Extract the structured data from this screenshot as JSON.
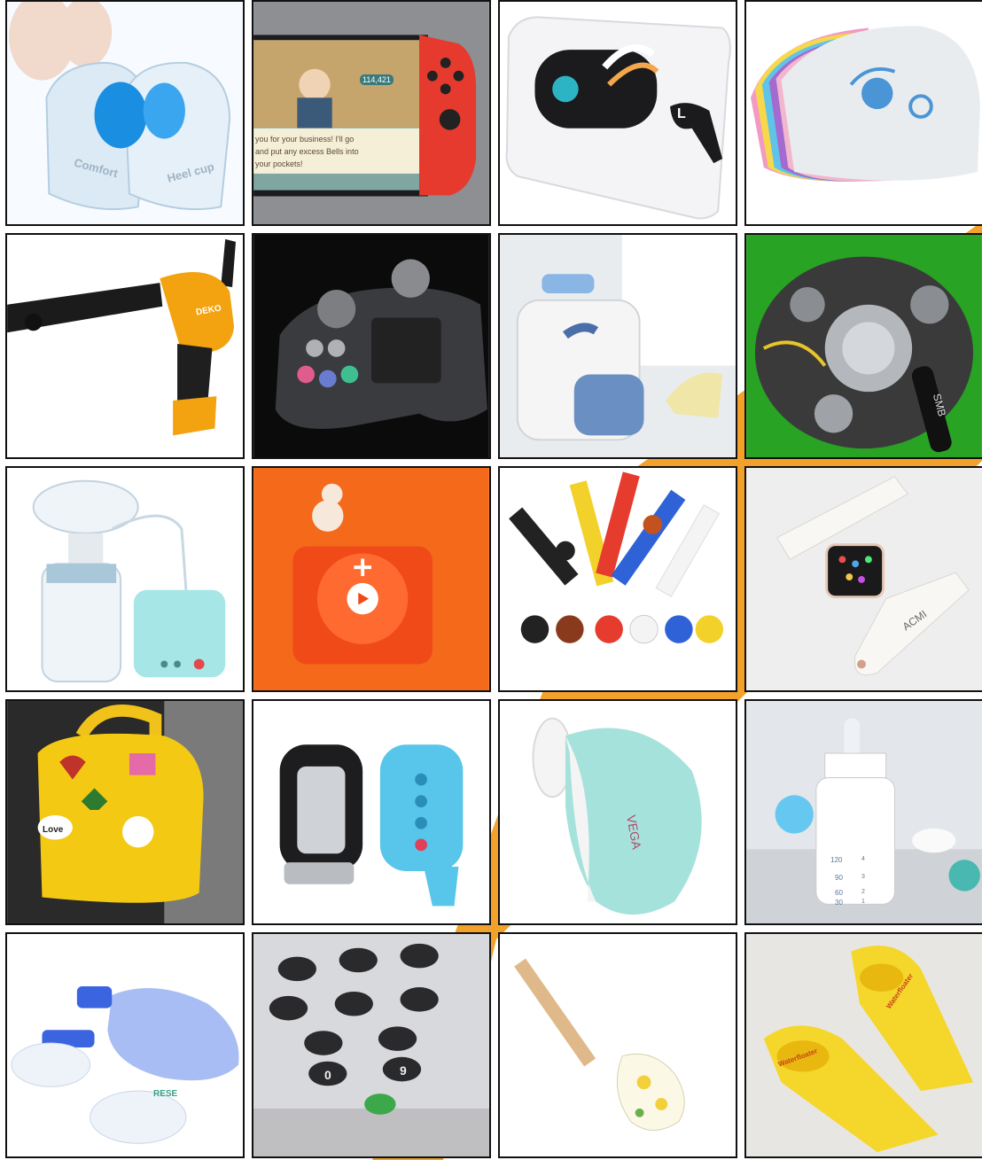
{
  "colors": {
    "accent_band": "#f2a22a",
    "tile_border": "#111111"
  },
  "tiles": [
    {
      "name": "heel-cups",
      "text": {
        "a": "Comfort",
        "b": "Heel cup"
      }
    },
    {
      "name": "game-console",
      "text": {
        "score": "114,421",
        "dialog1": "you for your business! I'll go",
        "dialog2": "and put any excess Bells into",
        "dialog3": "your pockets!"
      }
    },
    {
      "name": "earbuds-case",
      "text": {
        "letter": "L"
      }
    },
    {
      "name": "swim-caps",
      "text": {}
    },
    {
      "name": "caulking-gun",
      "text": {
        "brand": "DEKO"
      }
    },
    {
      "name": "game-controller",
      "text": {}
    },
    {
      "name": "bags-accessories",
      "text": {}
    },
    {
      "name": "car-engine",
      "text": {
        "hose": "SMB"
      }
    },
    {
      "name": "breast-pump",
      "text": {}
    },
    {
      "name": "music-player",
      "text": {}
    },
    {
      "name": "slap-bracelets",
      "text": {}
    },
    {
      "name": "watch-band",
      "text": {
        "band": "ACMI"
      }
    },
    {
      "name": "backpack",
      "text": {
        "badge": "Love"
      }
    },
    {
      "name": "key-fob-cover",
      "text": {}
    },
    {
      "name": "face-brush",
      "text": {
        "brand": "VEGA"
      }
    },
    {
      "name": "baby-bottle",
      "text": {
        "m1": "120",
        "m2": "90",
        "m3": "60",
        "m4": "30",
        "n4": "4",
        "n3": "3",
        "n2": "2",
        "n1": "1"
      }
    },
    {
      "name": "resuscitator",
      "text": {
        "mask": "RESE"
      }
    },
    {
      "name": "keypad",
      "text": {
        "k0": "0",
        "k9": "9"
      }
    },
    {
      "name": "spatula",
      "text": {}
    },
    {
      "name": "swim-fins",
      "text": {
        "brand": "Waterfloater"
      }
    }
  ]
}
